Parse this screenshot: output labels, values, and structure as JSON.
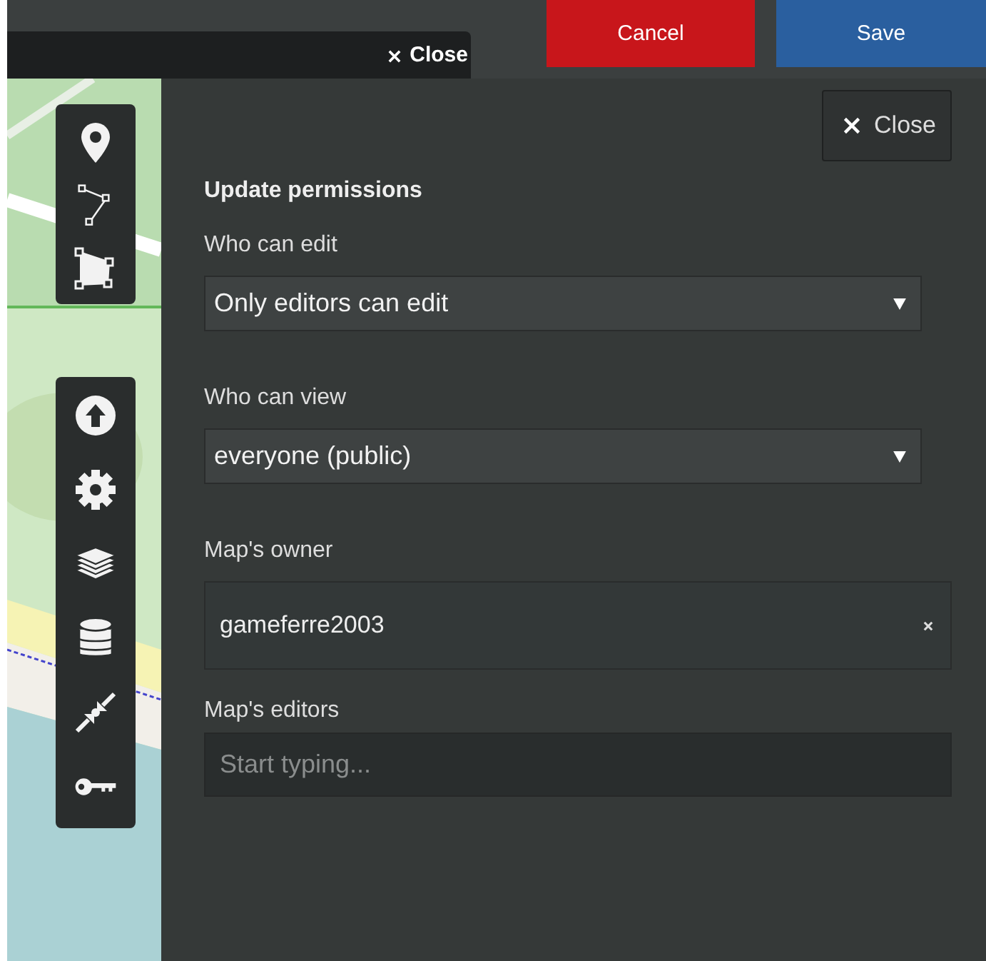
{
  "top_bar": {
    "close_label": "Close",
    "buttons": [
      {
        "label": "Cancel",
        "kind": "cancel"
      },
      {
        "label": "Save",
        "kind": "save"
      }
    ]
  },
  "panel": {
    "close_label": "Close",
    "title": "Update permissions",
    "fields": [
      {
        "label": "Who can edit",
        "kind": "select",
        "value": "Only editors can edit"
      },
      {
        "label": "Who can view",
        "kind": "select",
        "value": "everyone (public)"
      },
      {
        "label": "Map's owner",
        "kind": "owner",
        "value": "gameferre2003"
      },
      {
        "label": "Map's editors",
        "kind": "input",
        "placeholder": "Start typing..."
      }
    ]
  }
}
